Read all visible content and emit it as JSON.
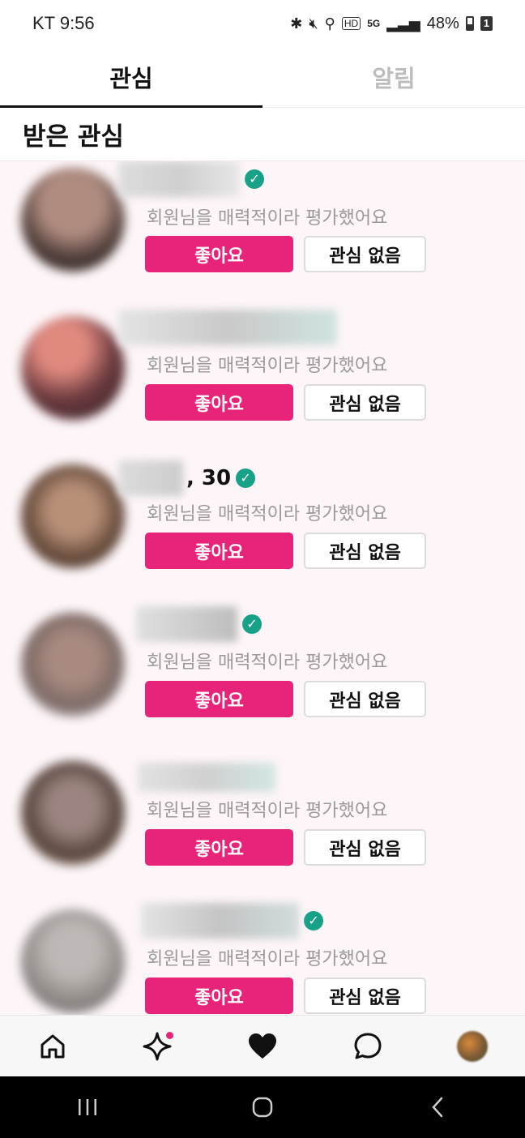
{
  "status_bar": {
    "carrier_time": "KT 9:56",
    "network": "5G",
    "battery_text": "48%",
    "sim": "1",
    "hd_label": "HD"
  },
  "tabs": [
    {
      "label": "관심",
      "active": true
    },
    {
      "label": "알림",
      "active": false
    }
  ],
  "section_title": "받은 관심",
  "cards": [
    {
      "name_visible": "",
      "verified": true,
      "avatar_color": "#5b4a45",
      "subtitle": "회원님을 매력적이라 평가했어요",
      "like_label": "좋아요",
      "pass_label": "관심 없음"
    },
    {
      "name_visible": "",
      "verified": false,
      "avatar_color": "#6b3a3e",
      "subtitle": "회원님을 매력적이라 평가했어요",
      "like_label": "좋아요",
      "pass_label": "관심 없음"
    },
    {
      "name_visible": ", 30",
      "verified": true,
      "avatar_color": "#6a4e3e",
      "subtitle": "회원님을 매력적이라 평가했어요",
      "like_label": "좋아요",
      "pass_label": "관심 없음"
    },
    {
      "name_visible": "",
      "verified": true,
      "avatar_color": "#7d6a66",
      "subtitle": "회원님을 매력적이라 평가했어요",
      "like_label": "좋아요",
      "pass_label": "관심 없음"
    },
    {
      "name_visible": "",
      "verified": false,
      "avatar_color": "#5a4740",
      "subtitle": "회원님을 매력적이라 평가했어요",
      "like_label": "좋아요",
      "pass_label": "관심 없음"
    },
    {
      "name_visible": "",
      "verified": true,
      "avatar_color": "#8a8683",
      "subtitle": "회원님을 매력적이라 평가했어요",
      "like_label": "좋아요",
      "pass_label": "관심 없음"
    }
  ],
  "bottom_nav": [
    "home-icon",
    "sparkle-icon",
    "heart-icon",
    "chat-icon",
    "profile-avatar"
  ],
  "colors": {
    "accent": "#e8247a",
    "verified": "#17a187",
    "list_bg": "#fdf5f8"
  }
}
